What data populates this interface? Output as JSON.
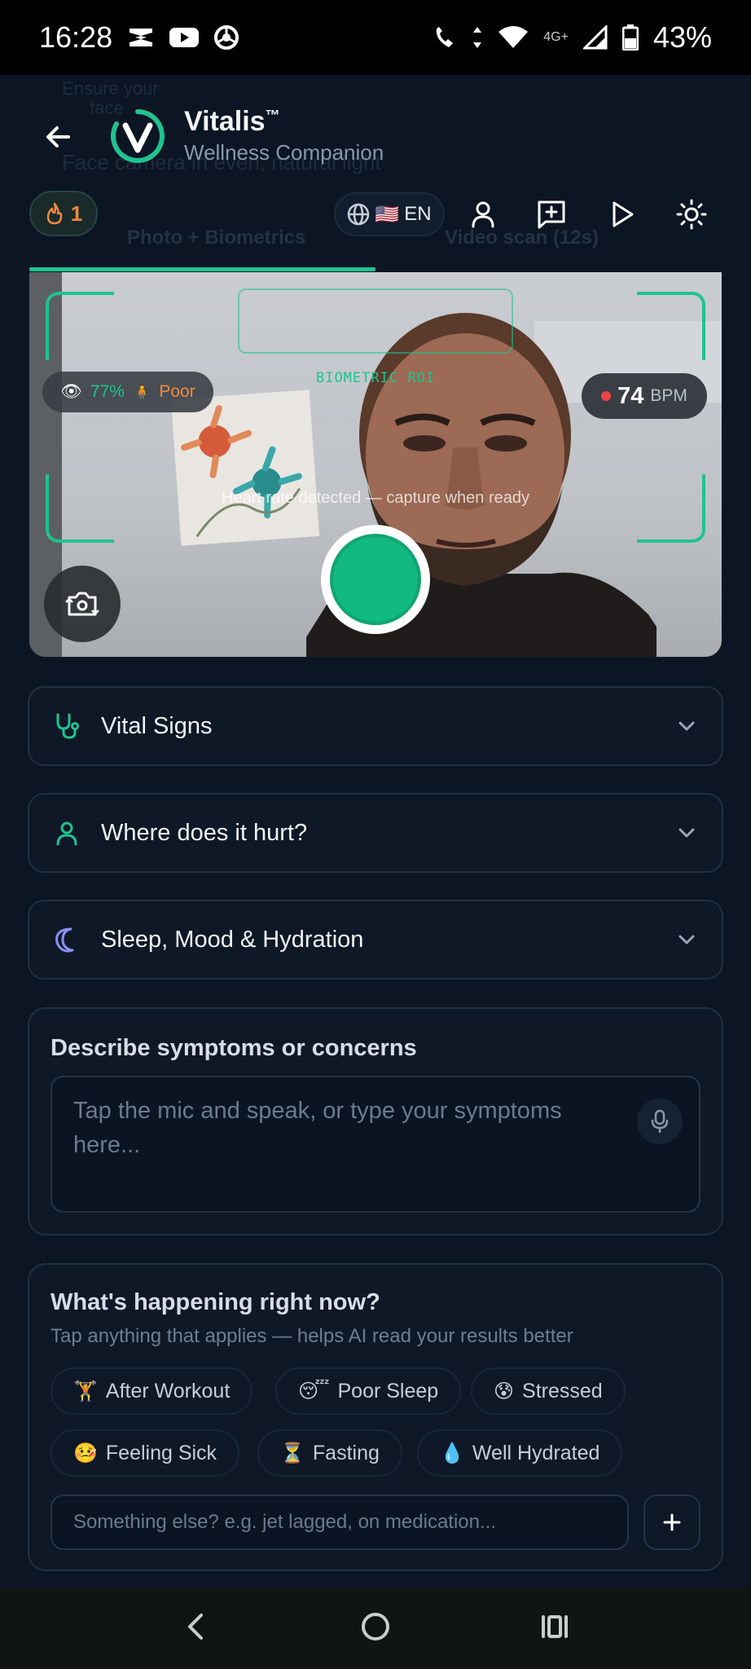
{
  "status_bar": {
    "time": "16:28",
    "battery": "43%",
    "network": "4G+"
  },
  "header": {
    "title": "Vitalis",
    "title_mark": "™",
    "subtitle": "Wellness Companion",
    "ghost_text_1": "Ensure your",
    "ghost_text_2": "face",
    "ghost_text_3": "Face camera in even, natural light",
    "streak_count": "1",
    "language": "EN",
    "flag": "🇺🇸"
  },
  "tabs": {
    "tab1": "Photo + Biometrics",
    "tab2": "Video scan (12s)",
    "progress_fraction": 0.5
  },
  "camera": {
    "roi_label": "BIOMETRIC ROI",
    "face_quality": "77%",
    "lighting": "Poor",
    "bpm_value": "74",
    "bpm_unit": "BPM",
    "hint": "Heart rate detected — capture when ready"
  },
  "sections": {
    "vitals": "Vital Signs",
    "pain": "Where does it hurt?",
    "sleep": "Sleep, Mood & Hydration"
  },
  "symptoms": {
    "title": "Describe symptoms or concerns",
    "placeholder": "Tap the mic and speak, or type your symptoms here..."
  },
  "context": {
    "title": "What's happening right now?",
    "subtitle": "Tap anything that applies — helps AI read your results better",
    "chips": [
      {
        "emoji": "🏋️",
        "label": "After Workout"
      },
      {
        "emoji": "😴",
        "label": "Poor Sleep"
      },
      {
        "emoji": "😰",
        "label": "Stressed"
      },
      {
        "emoji": "🤒",
        "label": "Feeling Sick"
      },
      {
        "emoji": "⏳",
        "label": "Fasting"
      },
      {
        "emoji": "💧",
        "label": "Well Hydrated"
      }
    ],
    "other_placeholder": "Something else? e.g. jet lagged, on medication..."
  },
  "colors": {
    "accent": "#1fc38e",
    "background": "#0c1524",
    "streak": "#f08a3e",
    "poor": "#f08a3e"
  }
}
